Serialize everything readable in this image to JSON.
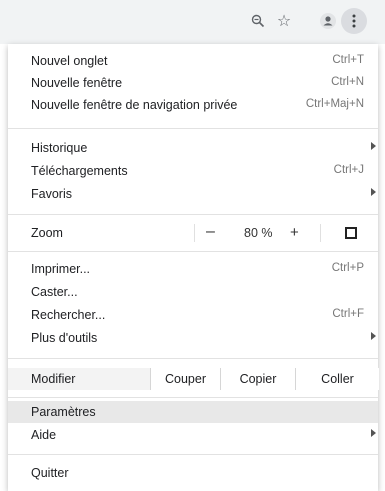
{
  "toolbar": {
    "icons": [
      "zoom-magnifier-icon",
      "bookmark-star-icon",
      "profile-icon",
      "more-vertical-icon"
    ]
  },
  "menu": {
    "new_tab": {
      "label": "Nouvel onglet",
      "shortcut": "Ctrl+T"
    },
    "new_window": {
      "label": "Nouvelle fenêtre",
      "shortcut": "Ctrl+N"
    },
    "incognito": {
      "label": "Nouvelle fenêtre de navigation privée",
      "shortcut": "Ctrl+Maj+N"
    },
    "history": {
      "label": "Historique"
    },
    "downloads": {
      "label": "Téléchargements",
      "shortcut": "Ctrl+J"
    },
    "bookmarks": {
      "label": "Favoris"
    },
    "zoom": {
      "label": "Zoom",
      "minus": "–",
      "value": "80 %",
      "plus": "+"
    },
    "print": {
      "label": "Imprimer...",
      "shortcut": "Ctrl+P"
    },
    "cast": {
      "label": "Caster..."
    },
    "find": {
      "label": "Rechercher...",
      "shortcut": "Ctrl+F"
    },
    "more_tools": {
      "label": "Plus d'outils"
    },
    "edit": {
      "label": "Modifier",
      "cut": "Couper",
      "copy": "Copier",
      "paste": "Coller"
    },
    "settings": {
      "label": "Paramètres"
    },
    "help": {
      "label": "Aide"
    },
    "quit": {
      "label": "Quitter"
    }
  },
  "colors": {
    "highlight": "#e8e8e8",
    "toolbar": "#f1f3f4"
  }
}
